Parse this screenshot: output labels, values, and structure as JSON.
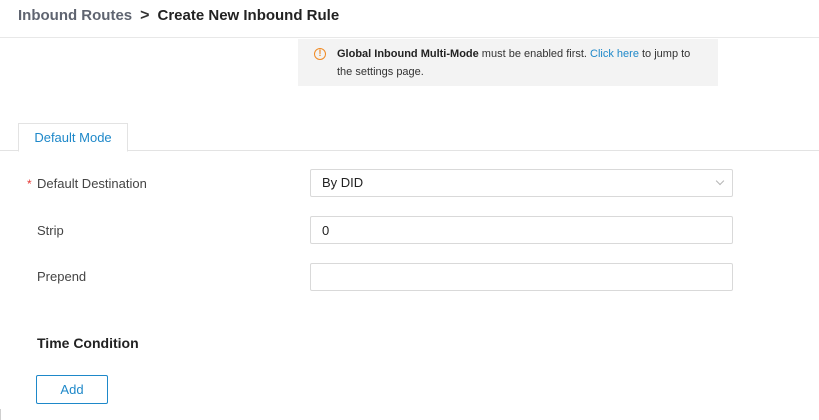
{
  "breadcrumb": {
    "parent": "Inbound Routes",
    "separator": ">",
    "current": "Create New Inbound Rule"
  },
  "banner": {
    "icon": "warning-circle-icon",
    "icon_glyph": "!",
    "bold_text": "Global Inbound Multi-Mode",
    "text_before_link": " must be enabled first. ",
    "link_text": "Click here",
    "text_after_link": " to jump to the settings page.",
    "accent_color": "#f08a24",
    "link_color": "#1e88c9"
  },
  "tabs": [
    {
      "label": "Default Mode",
      "active": true
    }
  ],
  "form": {
    "default_destination": {
      "required_mark": "*",
      "label": "Default Destination",
      "value": "By DID"
    },
    "strip": {
      "label": "Strip",
      "value": "0"
    },
    "prepend": {
      "label": "Prepend",
      "value": ""
    }
  },
  "time_condition": {
    "title": "Time Condition",
    "add_label": "Add"
  },
  "colors": {
    "primary": "#1e88c9",
    "required": "#e53935",
    "banner_bg": "#f3f3f3"
  }
}
